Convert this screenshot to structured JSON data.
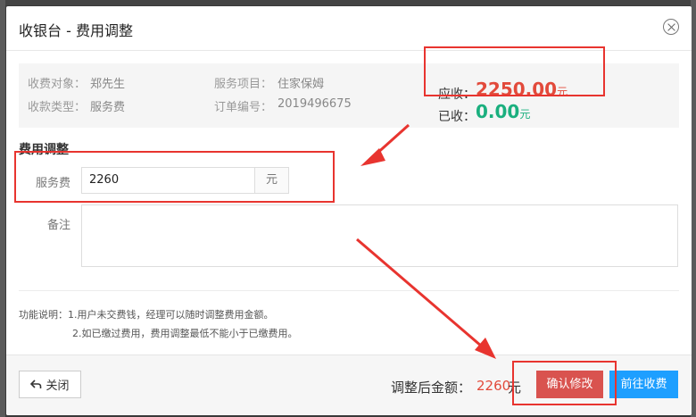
{
  "modal": {
    "title": "收银台 - 费用调整"
  },
  "info": {
    "payer_label": "收费对象：",
    "payer_value": "郑先生",
    "service_label": "服务项目：",
    "service_value": "住家保姆",
    "type_label": "收款类型：",
    "type_value": "服务费",
    "order_label": "订单编号：",
    "order_value": "2019496675",
    "due_label": "应收：",
    "due_value": "2250.00",
    "due_unit": "元",
    "paid_label": "已收：",
    "paid_value": "0.00",
    "paid_unit": "元"
  },
  "form": {
    "section_title": "费用调整",
    "fee_label": "服务费",
    "fee_value": "2260",
    "fee_unit": "元",
    "remark_label": "备注",
    "remark_value": ""
  },
  "notes": {
    "line1": "功能说明：1.用户未交费钱，经理可以随时调整费用金额。",
    "line2": "2.如已缴过费用，费用调整最低不能小于已缴费用。"
  },
  "footer": {
    "close_label": "关闭",
    "after_label": "调整后金额：",
    "after_value": "2260",
    "after_unit": "元",
    "confirm_label": "确认修改",
    "goto_label": "前往收费"
  },
  "colors": {
    "due_amount": "#e24a3b",
    "paid_amount": "#1aaf7e",
    "confirm_button": "#d9534f",
    "goto_button": "#1e9fff",
    "highlight": "#e8342f"
  }
}
